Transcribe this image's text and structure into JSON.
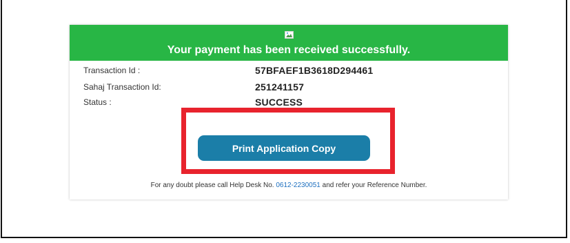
{
  "banner": {
    "icon": "broken-image-icon",
    "message": "Your payment has been received successfully.",
    "color": "#28b645"
  },
  "details": [
    {
      "label": "Transaction Id :",
      "value": "57BFAEF1B3618D294461"
    },
    {
      "label": "Sahaj Transaction Id:",
      "value": "251241157"
    },
    {
      "label": "Status :",
      "value": "SUCCESS"
    }
  ],
  "print_button": {
    "label": "Print Application Copy",
    "color": "#1b7ea8"
  },
  "highlight": {
    "color": "#e8232d"
  },
  "helpline": {
    "prefix": "For any doubt please call Help Desk No.",
    "phone": "0612-2230051",
    "suffix": "and refer your Reference Number."
  }
}
